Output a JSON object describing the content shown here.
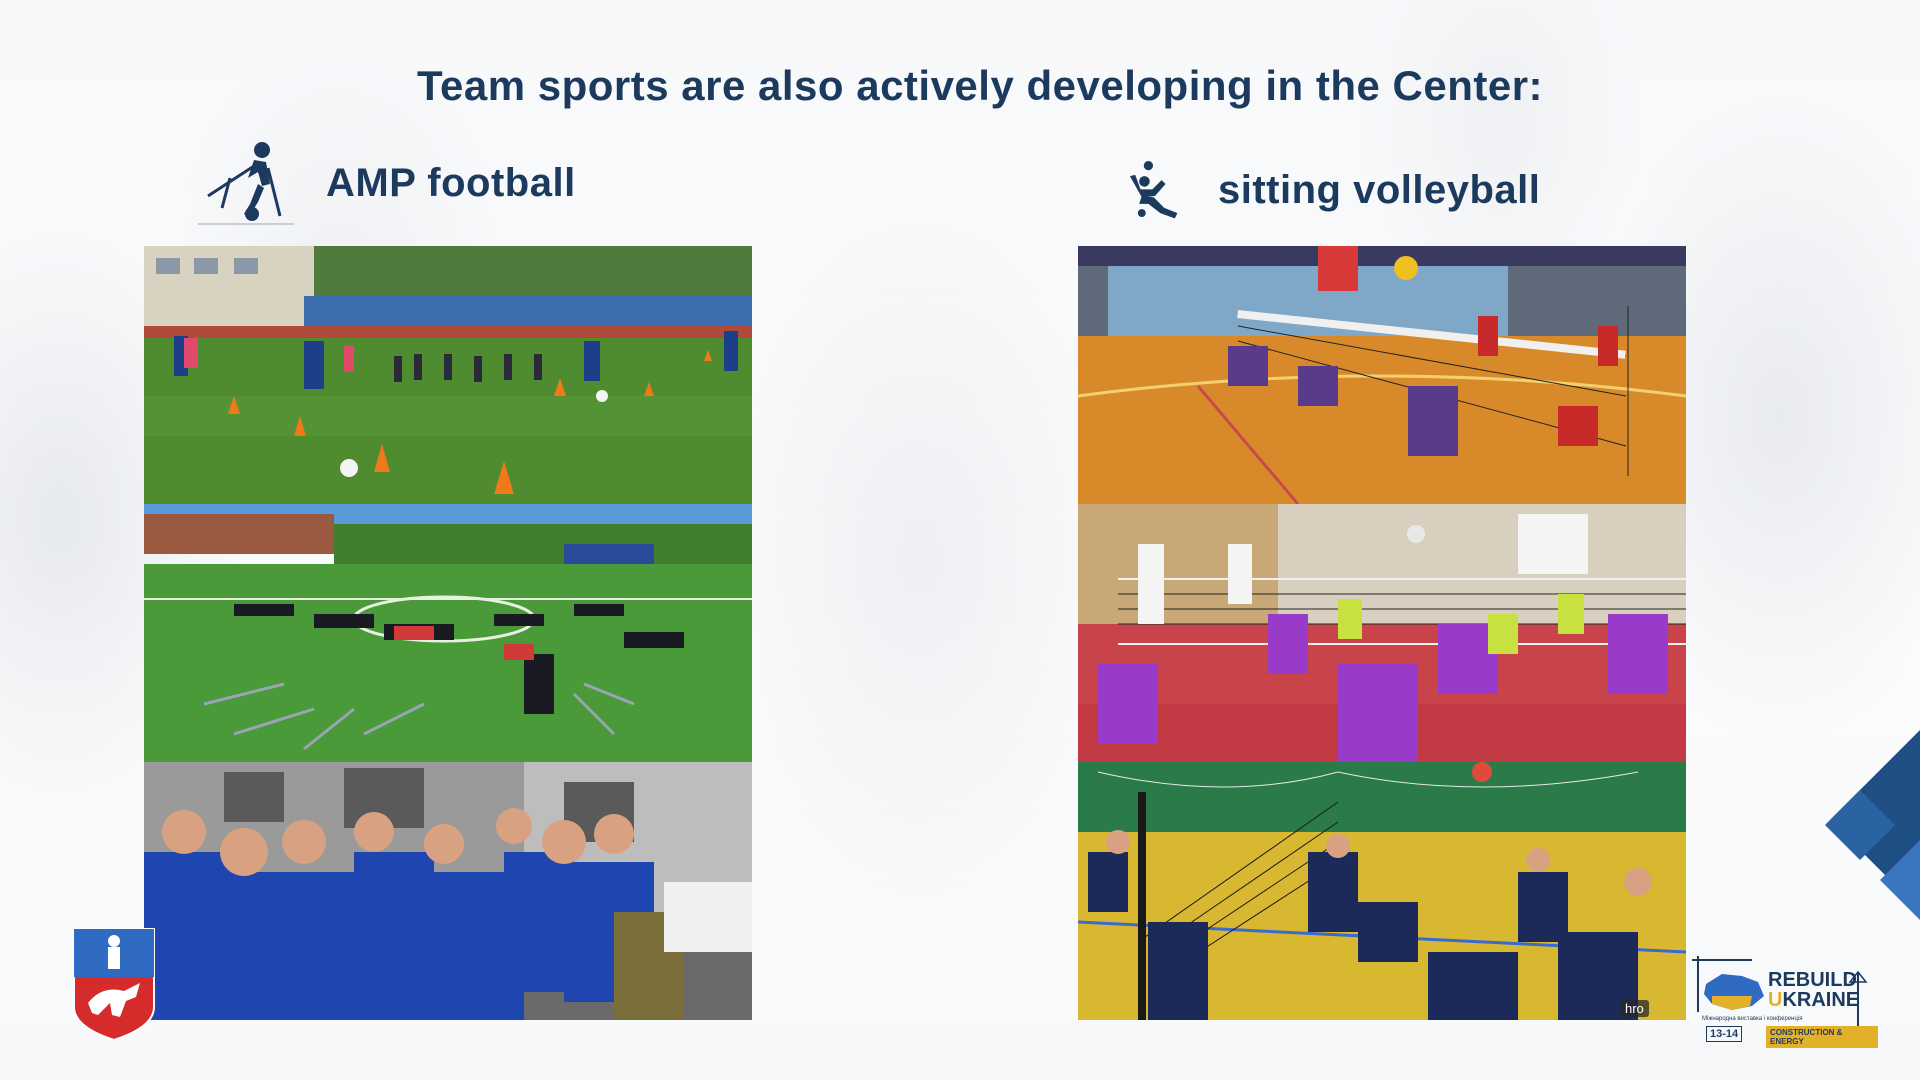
{
  "slide": {
    "title": "Team sports are also actively developing in the Center:"
  },
  "sports": [
    {
      "label": "AMP football",
      "icon": "amp-football-player-icon"
    },
    {
      "label": "sitting volleyball",
      "icon": "sitting-volleyball-player-icon"
    }
  ],
  "watermark": "hro",
  "branding": {
    "rebuild_line1": "REBUILD",
    "rebuild_line2_a": "U",
    "rebuild_line2_b": "KRAINE",
    "rebuild_subtitle": "Міжнародна виставка і конференція",
    "rebuild_dates": "13-14",
    "rebuild_theme": "CONSTRUCTION & ENERGY"
  },
  "colors": {
    "heading": "#1c3a5e",
    "accent_blue": "#1f4e85",
    "accent_yellow": "#e3b02a"
  }
}
